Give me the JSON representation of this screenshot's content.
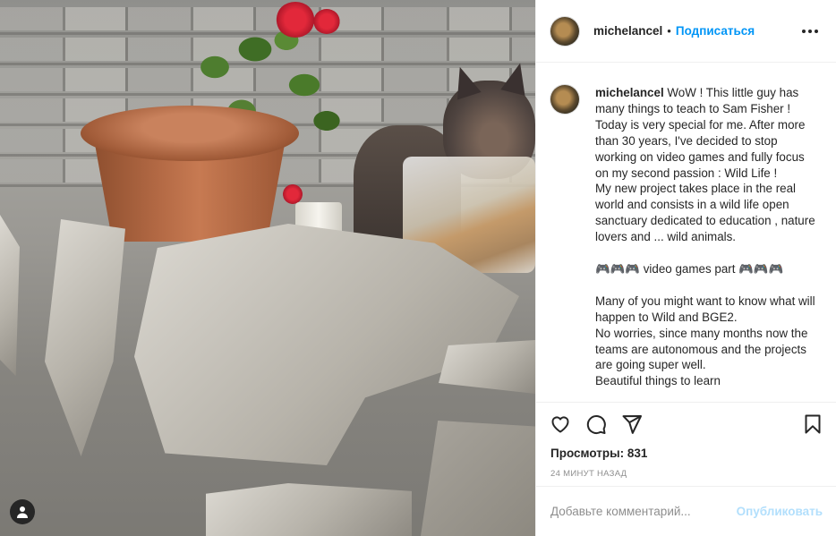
{
  "post": {
    "username": "michelancel",
    "separator": "•",
    "follow_label": "Подписаться",
    "more_icon": "more-horizontal-icon"
  },
  "caption": {
    "username": "michelancel",
    "text": " WoW ! This little guy has many things to teach to Sam Fisher !\nToday is very special for me. After more than 30 years, I've decided to stop working on video games and fully focus on my second passion : Wild Life !\nMy new project takes place in the real world and consists in a wild life open sanctuary dedicated to education , nature lovers and ... wild animals.\n\n🎮🎮🎮 video games part 🎮🎮🎮\n\nMany of you might want to know what will happen to Wild and BGE2.\nNo worries, since many months now the teams are autonomous and the projects are going super well.\nBeautiful things to learn"
  },
  "actions": {
    "like_icon": "heart-icon",
    "comment_icon": "comment-icon",
    "share_icon": "paper-plane-icon",
    "save_icon": "bookmark-icon"
  },
  "stats": {
    "views_label": "Просмотры: 831",
    "timestamp": "24 минут назад"
  },
  "comment": {
    "placeholder": "Добавьте комментарий...",
    "publish_label": "Опубликовать"
  },
  "colors": {
    "accent": "#0095f6",
    "publish_disabled": "#b2dffc",
    "text": "#262626",
    "muted": "#8e8e8e",
    "border": "#efefef"
  }
}
